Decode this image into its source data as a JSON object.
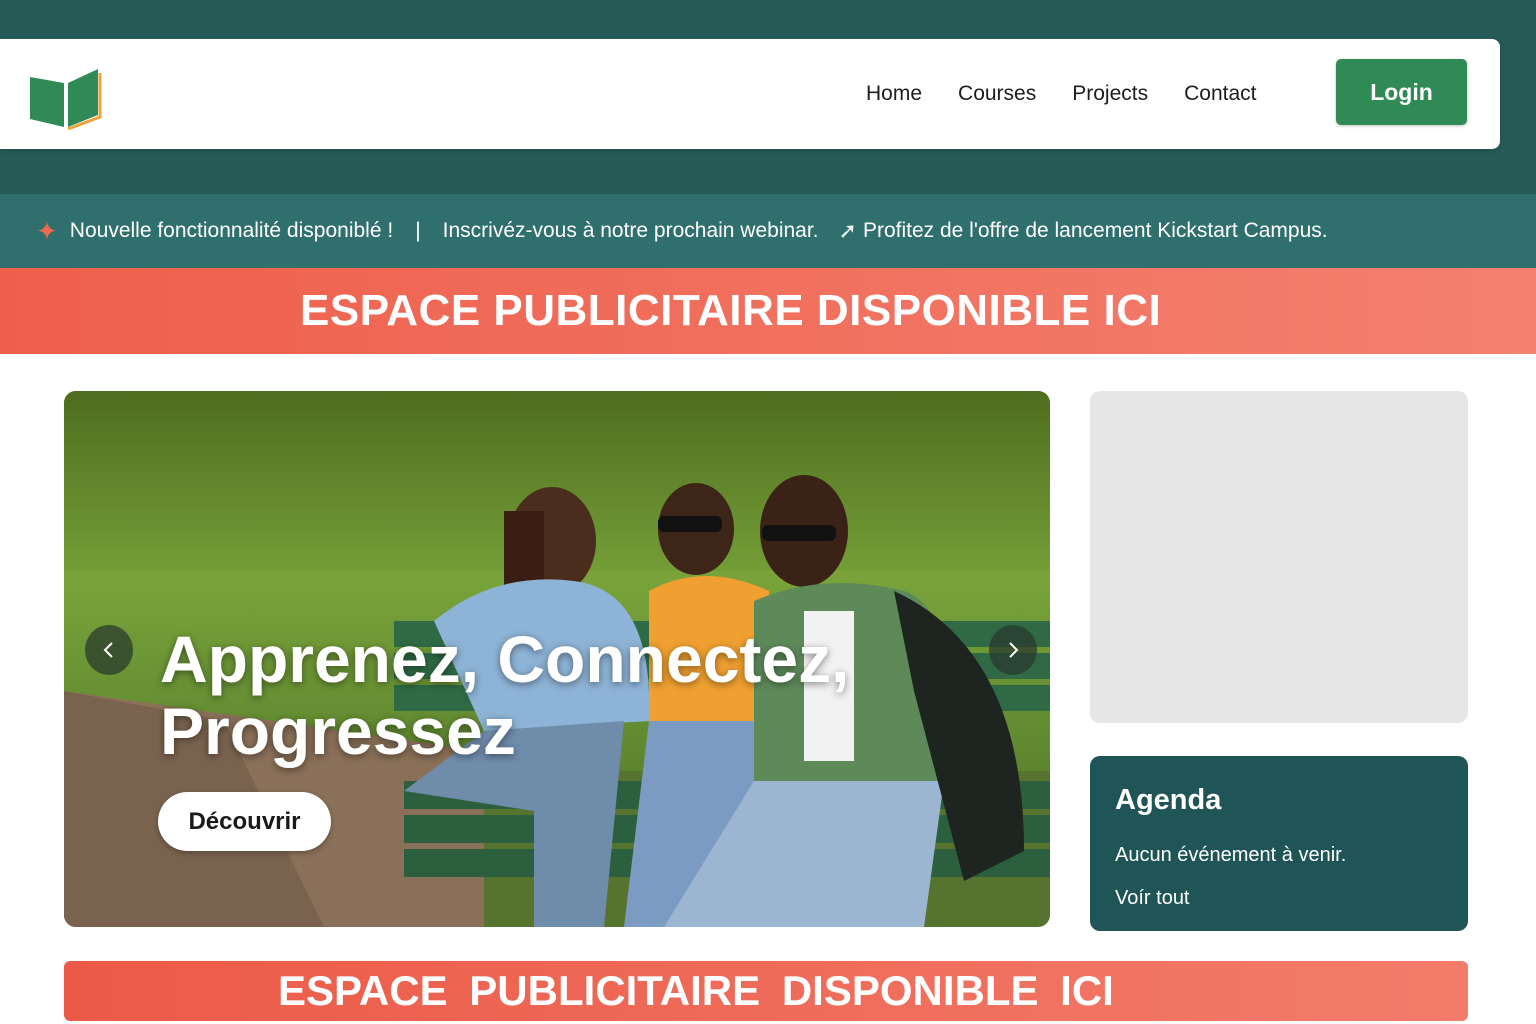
{
  "colors": {
    "header_band": "#275b58",
    "ticker": "#2f6f6d",
    "brand_green": "#2f8a56",
    "ad_coral": "#ee5f4b",
    "agenda_bg": "#1f5556"
  },
  "header": {
    "logo_icon": "open-book-icon",
    "nav": [
      "Home",
      "Courses",
      "Projects",
      "Contact"
    ],
    "login_label": "Login"
  },
  "ticker": {
    "icon": "party-popper-icon",
    "item1": "Nouvelle fonctionnalité disponiblé !",
    "separator": "|",
    "item2": "Inscrivéz-vous à notre prochain webinar.",
    "rocket_icon": "rocket-icon",
    "item3": "Profitez de l'offre de lancement Kickstart Campus."
  },
  "ads": {
    "top": "ESPACE PUBLICITAIRE DISPONIBLE ICI",
    "bottom": "ESPACE PUBLICITAIRE  DISPONIBLE  ICI"
  },
  "hero": {
    "title_line1": "Apprenez, Connectez,",
    "title_line2": "Progressez",
    "cta_label": "Découvrir",
    "prev_icon": "chevron-left-icon",
    "next_icon": "chevron-right-icon",
    "image": "students-on-bench-photo"
  },
  "agenda": {
    "title": "Agenda",
    "empty_text": "Aucun événement à venir.",
    "link_label": "Voír tout"
  }
}
